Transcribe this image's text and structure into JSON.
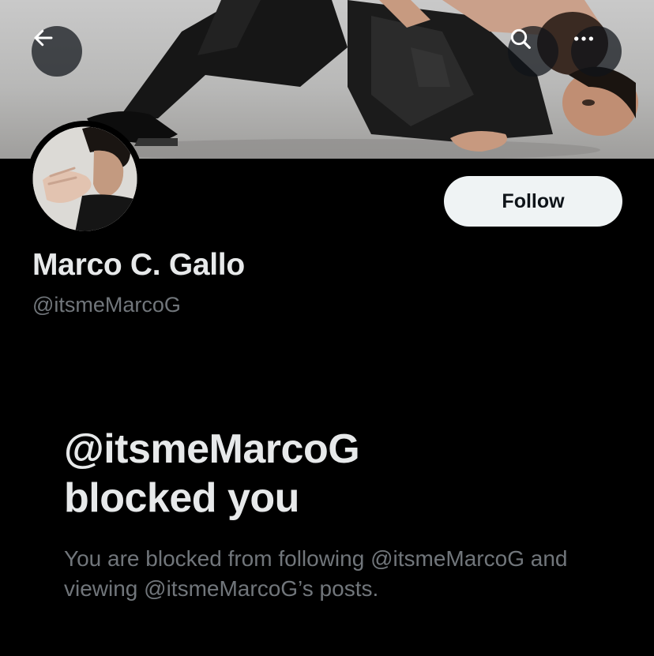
{
  "header": {
    "back_icon": "arrow-left-icon",
    "search_icon": "search-icon",
    "more_icon": "more-horizontal-icon"
  },
  "profile": {
    "display_name": "Marco C. Gallo",
    "handle": "@itsmeMarcoG",
    "follow_label": "Follow"
  },
  "blocked": {
    "title_line1": "@itsmeMarcoG",
    "title_line2": "blocked you",
    "description": "You are blocked from following @itsmeMarcoG and viewing @itsmeMarcoG’s posts."
  },
  "colors": {
    "background": "#000000",
    "primary_text": "#e7e9ea",
    "secondary_text": "#71767b",
    "follow_button_bg": "#eff3f4",
    "follow_button_text": "#0f1419"
  }
}
